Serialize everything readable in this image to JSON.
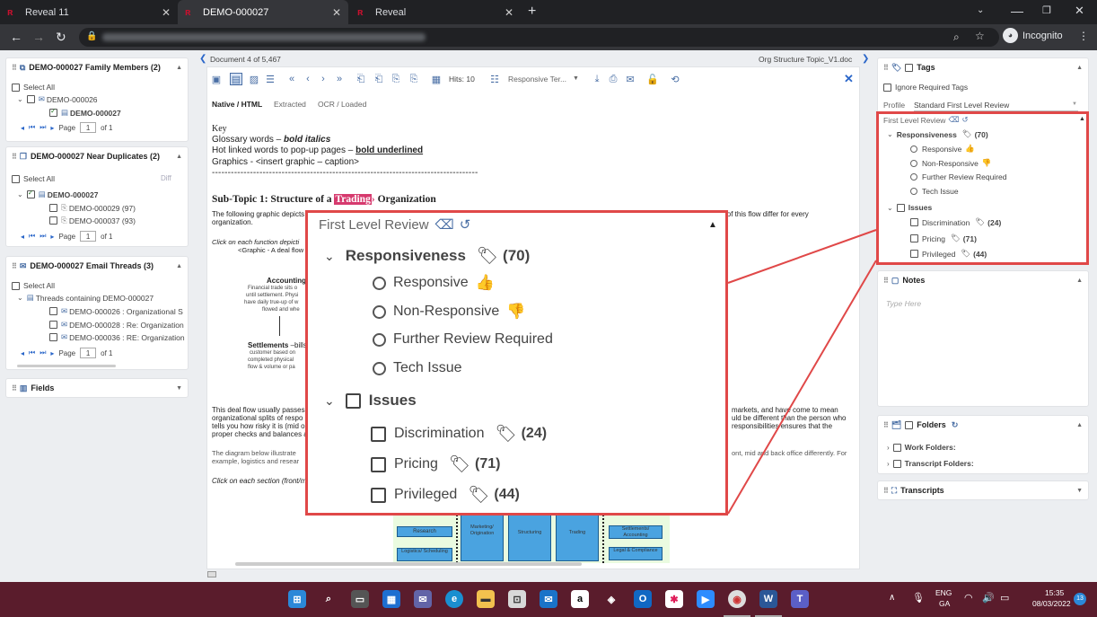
{
  "browser": {
    "tabs": [
      {
        "title": "Reveal 11"
      },
      {
        "title": "DEMO-000027"
      },
      {
        "title": "Reveal"
      }
    ],
    "profile": "Incognito"
  },
  "family_panel": {
    "title": "DEMO-000027 Family Members (2)",
    "select_all": "Select All",
    "items": [
      "DEMO-000026",
      "DEMO-000027"
    ],
    "page_label": "Page",
    "page_value": "1",
    "page_of": "of 1"
  },
  "near_dup_panel": {
    "title": "DEMO-000027 Near Duplicates (2)",
    "select_all": "Select All",
    "diff": "Diff",
    "items": [
      "DEMO-000027",
      "DEMO-000029 (97)",
      "DEMO-000037 (93)"
    ],
    "page_label": "Page",
    "page_value": "1",
    "page_of": "of 1"
  },
  "email_panel": {
    "title": "DEMO-000027 Email Threads (3)",
    "select_all": "Select All",
    "group": "Threads containing DEMO-000027",
    "items": [
      "DEMO-000026 : Organizational S",
      "DEMO-000028 : Re: Organization",
      "DEMO-000036 : RE: Organization"
    ],
    "page_label": "Page",
    "page_value": "1",
    "page_of": "of 1"
  },
  "fields_panel": {
    "title": "Fields"
  },
  "doc_header": {
    "position": "Document 4 of 5,467",
    "filename": "Org Structure Topic_V1.doc"
  },
  "doc_toolbar": {
    "hits": "Hits: 10",
    "terms": "Responsive Ter..."
  },
  "view_tabs": [
    "Native / HTML",
    "Extracted",
    "OCR / Loaded"
  ],
  "document": {
    "key": "Key",
    "line1_a": "Glossary words – ",
    "line1_b": "bold italics",
    "line2_a": "Hot linked words to pop-up pages – ",
    "line2_b": "bold underlined",
    "line3": "Graphics - <insert graphic – caption>",
    "dashes": "------------------------------------------------------------------------------------",
    "heading_a": "Sub-Topic 1: Structure of a ",
    "heading_hit": "Trading",
    "heading_b": " Organization",
    "p1": "The following graphic depicts",
    "p1_end": "ils of this flow differ for every",
    "p1_2": "organization.",
    "click1": "Click on each function depicti",
    "graphic": "<Graphic - A deal flow",
    "accounting_title": "Accounting",
    "accounting_text": [
      "Financial trade sits o",
      "until settlement. Physi",
      "have daily true-up of w",
      "flowed and whe"
    ],
    "settlements_title": "Settlements",
    "settlements_rest": " –bills",
    "settlements_text": [
      "customer based on",
      "completed physical",
      "flow & volume or pa"
    ],
    "p2": [
      "This deal flow usually passes",
      "organizational splits of respo",
      "tells you how risky it is (mid o",
      "proper checks and balances a"
    ],
    "p2_end": [
      "markets, and have come to mean",
      "uld be different than the person who",
      "responsibilities ensures that the"
    ],
    "p3": [
      "The diagram below illustrate",
      "example, logistics and resear"
    ],
    "p3_end": "ont, mid and back office differently.  For",
    "click2": "Click on each section (front/m",
    "diagram": {
      "c1": [
        "Research",
        "Logistics/ Scheduling"
      ],
      "c2": "Marketing/ Origination",
      "c3": "Structuring",
      "c4": "Trading",
      "c5": [
        "Settlements/ Accounting",
        "Legal & Compliance"
      ]
    }
  },
  "tags_panel": {
    "title": "Tags",
    "ignore_required": "Ignore Required Tags",
    "profile_label": "Profile",
    "profile_value": "Standard First Level Review",
    "review_title": "First Level Review",
    "responsiveness": {
      "label": "Responsiveness",
      "count": "(70)",
      "options": [
        "Responsive",
        "Non-Responsive",
        "Further Review Required",
        "Tech Issue"
      ]
    },
    "issues": {
      "label": "Issues",
      "items": [
        {
          "label": "Discrimination",
          "count": "(24)"
        },
        {
          "label": "Pricing",
          "count": "(71)"
        },
        {
          "label": "Privileged",
          "count": "(44)"
        }
      ]
    }
  },
  "notes_panel": {
    "title": "Notes",
    "placeholder": "Type Here"
  },
  "folders_panel": {
    "title": "Folders",
    "items": [
      "Work Folders:",
      "Transcript Folders:"
    ]
  },
  "transcripts_panel": {
    "title": "Transcripts"
  },
  "taskbar": {
    "lang1": "ENG",
    "lang2": "GA",
    "time": "15:35",
    "date": "08/03/2022",
    "badge": "13"
  }
}
